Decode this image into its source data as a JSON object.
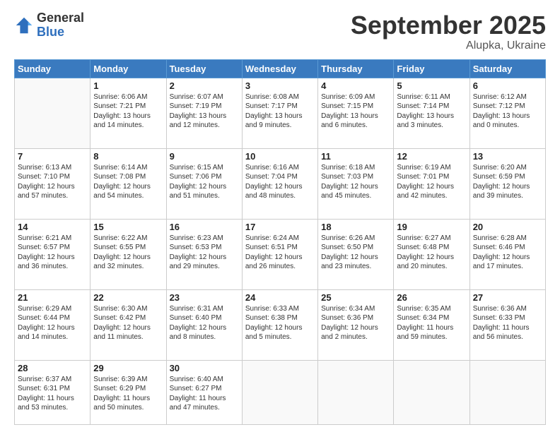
{
  "logo": {
    "general": "General",
    "blue": "Blue"
  },
  "title": {
    "month": "September 2025",
    "location": "Alupka, Ukraine"
  },
  "weekdays": [
    "Sunday",
    "Monday",
    "Tuesday",
    "Wednesday",
    "Thursday",
    "Friday",
    "Saturday"
  ],
  "weeks": [
    [
      {
        "day": "",
        "info": ""
      },
      {
        "day": "1",
        "info": "Sunrise: 6:06 AM\nSunset: 7:21 PM\nDaylight: 13 hours\nand 14 minutes."
      },
      {
        "day": "2",
        "info": "Sunrise: 6:07 AM\nSunset: 7:19 PM\nDaylight: 13 hours\nand 12 minutes."
      },
      {
        "day": "3",
        "info": "Sunrise: 6:08 AM\nSunset: 7:17 PM\nDaylight: 13 hours\nand 9 minutes."
      },
      {
        "day": "4",
        "info": "Sunrise: 6:09 AM\nSunset: 7:15 PM\nDaylight: 13 hours\nand 6 minutes."
      },
      {
        "day": "5",
        "info": "Sunrise: 6:11 AM\nSunset: 7:14 PM\nDaylight: 13 hours\nand 3 minutes."
      },
      {
        "day": "6",
        "info": "Sunrise: 6:12 AM\nSunset: 7:12 PM\nDaylight: 13 hours\nand 0 minutes."
      }
    ],
    [
      {
        "day": "7",
        "info": "Sunrise: 6:13 AM\nSunset: 7:10 PM\nDaylight: 12 hours\nand 57 minutes."
      },
      {
        "day": "8",
        "info": "Sunrise: 6:14 AM\nSunset: 7:08 PM\nDaylight: 12 hours\nand 54 minutes."
      },
      {
        "day": "9",
        "info": "Sunrise: 6:15 AM\nSunset: 7:06 PM\nDaylight: 12 hours\nand 51 minutes."
      },
      {
        "day": "10",
        "info": "Sunrise: 6:16 AM\nSunset: 7:04 PM\nDaylight: 12 hours\nand 48 minutes."
      },
      {
        "day": "11",
        "info": "Sunrise: 6:18 AM\nSunset: 7:03 PM\nDaylight: 12 hours\nand 45 minutes."
      },
      {
        "day": "12",
        "info": "Sunrise: 6:19 AM\nSunset: 7:01 PM\nDaylight: 12 hours\nand 42 minutes."
      },
      {
        "day": "13",
        "info": "Sunrise: 6:20 AM\nSunset: 6:59 PM\nDaylight: 12 hours\nand 39 minutes."
      }
    ],
    [
      {
        "day": "14",
        "info": "Sunrise: 6:21 AM\nSunset: 6:57 PM\nDaylight: 12 hours\nand 36 minutes."
      },
      {
        "day": "15",
        "info": "Sunrise: 6:22 AM\nSunset: 6:55 PM\nDaylight: 12 hours\nand 32 minutes."
      },
      {
        "day": "16",
        "info": "Sunrise: 6:23 AM\nSunset: 6:53 PM\nDaylight: 12 hours\nand 29 minutes."
      },
      {
        "day": "17",
        "info": "Sunrise: 6:24 AM\nSunset: 6:51 PM\nDaylight: 12 hours\nand 26 minutes."
      },
      {
        "day": "18",
        "info": "Sunrise: 6:26 AM\nSunset: 6:50 PM\nDaylight: 12 hours\nand 23 minutes."
      },
      {
        "day": "19",
        "info": "Sunrise: 6:27 AM\nSunset: 6:48 PM\nDaylight: 12 hours\nand 20 minutes."
      },
      {
        "day": "20",
        "info": "Sunrise: 6:28 AM\nSunset: 6:46 PM\nDaylight: 12 hours\nand 17 minutes."
      }
    ],
    [
      {
        "day": "21",
        "info": "Sunrise: 6:29 AM\nSunset: 6:44 PM\nDaylight: 12 hours\nand 14 minutes."
      },
      {
        "day": "22",
        "info": "Sunrise: 6:30 AM\nSunset: 6:42 PM\nDaylight: 12 hours\nand 11 minutes."
      },
      {
        "day": "23",
        "info": "Sunrise: 6:31 AM\nSunset: 6:40 PM\nDaylight: 12 hours\nand 8 minutes."
      },
      {
        "day": "24",
        "info": "Sunrise: 6:33 AM\nSunset: 6:38 PM\nDaylight: 12 hours\nand 5 minutes."
      },
      {
        "day": "25",
        "info": "Sunrise: 6:34 AM\nSunset: 6:36 PM\nDaylight: 12 hours\nand 2 minutes."
      },
      {
        "day": "26",
        "info": "Sunrise: 6:35 AM\nSunset: 6:34 PM\nDaylight: 11 hours\nand 59 minutes."
      },
      {
        "day": "27",
        "info": "Sunrise: 6:36 AM\nSunset: 6:33 PM\nDaylight: 11 hours\nand 56 minutes."
      }
    ],
    [
      {
        "day": "28",
        "info": "Sunrise: 6:37 AM\nSunset: 6:31 PM\nDaylight: 11 hours\nand 53 minutes."
      },
      {
        "day": "29",
        "info": "Sunrise: 6:39 AM\nSunset: 6:29 PM\nDaylight: 11 hours\nand 50 minutes."
      },
      {
        "day": "30",
        "info": "Sunrise: 6:40 AM\nSunset: 6:27 PM\nDaylight: 11 hours\nand 47 minutes."
      },
      {
        "day": "",
        "info": ""
      },
      {
        "day": "",
        "info": ""
      },
      {
        "day": "",
        "info": ""
      },
      {
        "day": "",
        "info": ""
      }
    ]
  ]
}
